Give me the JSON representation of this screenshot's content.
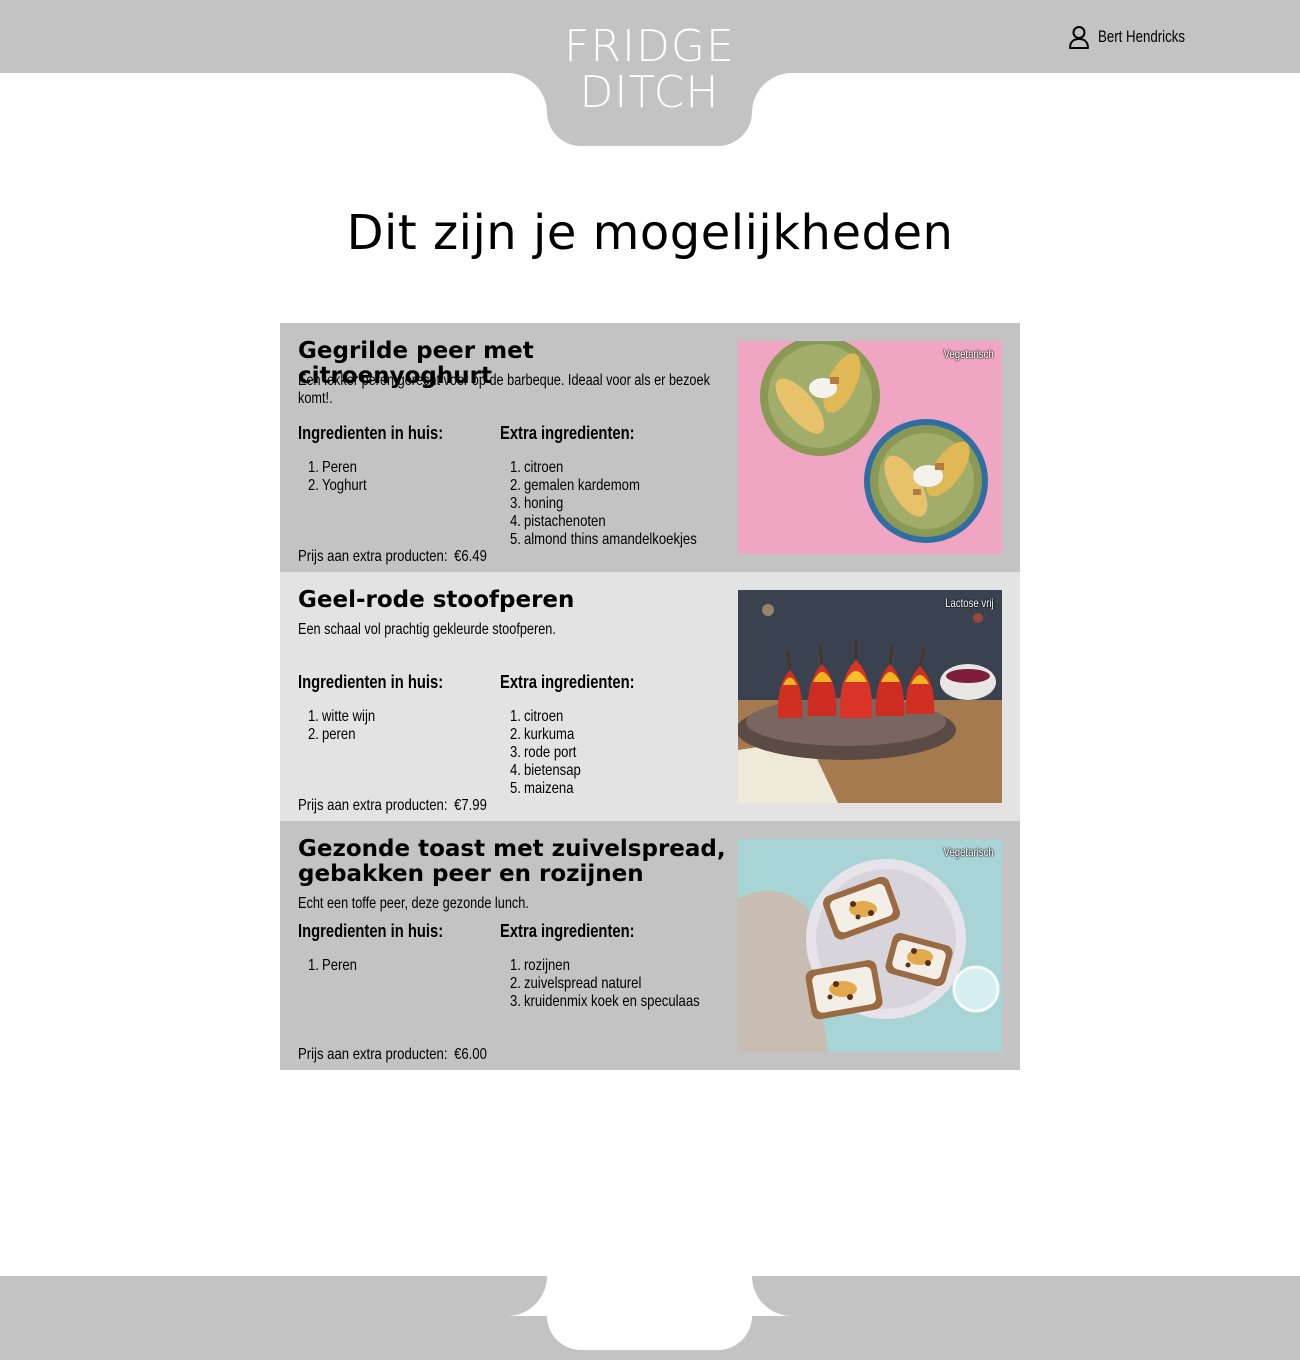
{
  "header": {
    "logo_line1": "FRIDGE",
    "logo_line2": "DITCH",
    "user_icon": "user-icon",
    "user_name": "Bert Hendricks"
  },
  "page_title": "Dit zijn je mogelijkheden",
  "labels": {
    "inhouse_heading": "Ingredienten in huis:",
    "extra_heading": "Extra ingredienten:",
    "price_label": "Prijs aan extra producten:"
  },
  "recipes": [
    {
      "title": "Gegrilde peer met citroenyoghurt",
      "description": "Een lekker peren gerecht voor op de barbeque. Ideaal voor als er bezoek komt!.",
      "inhouse": [
        "Peren",
        "Yoghurt"
      ],
      "extra": [
        "citroen",
        "gemalen kardemom",
        "honing",
        "pistachenoten",
        "almond thins amandelkoekjes"
      ],
      "price": "€6.49",
      "tag": "Vegetarisch",
      "background": "#c3c3c3"
    },
    {
      "title": "Geel-rode stoofperen",
      "description": "Een schaal vol prachtig gekleurde stoofperen.",
      "inhouse": [
        "witte wijn",
        "peren"
      ],
      "extra": [
        "citroen",
        "kurkuma",
        "rode port",
        "bietensap",
        "maizena"
      ],
      "price": "€7.99",
      "tag": "Lactose vrij",
      "background": "#e3e3e3"
    },
    {
      "title": "Gezonde toast met zuivelspread, gebakken peer en rozijnen",
      "description": "Echt een toffe peer, deze gezonde lunch.",
      "inhouse": [
        "Peren"
      ],
      "extra": [
        "rozijnen",
        "zuivelspread naturel",
        "kruidenmix koek en speculaas"
      ],
      "price": "€6.00",
      "tag": "Vegetarisch",
      "background": "#c3c3c3"
    }
  ],
  "colors": {
    "bar_gray": "#c3c3c3",
    "card_light": "#e3e3e3",
    "background": "#ffffff"
  }
}
